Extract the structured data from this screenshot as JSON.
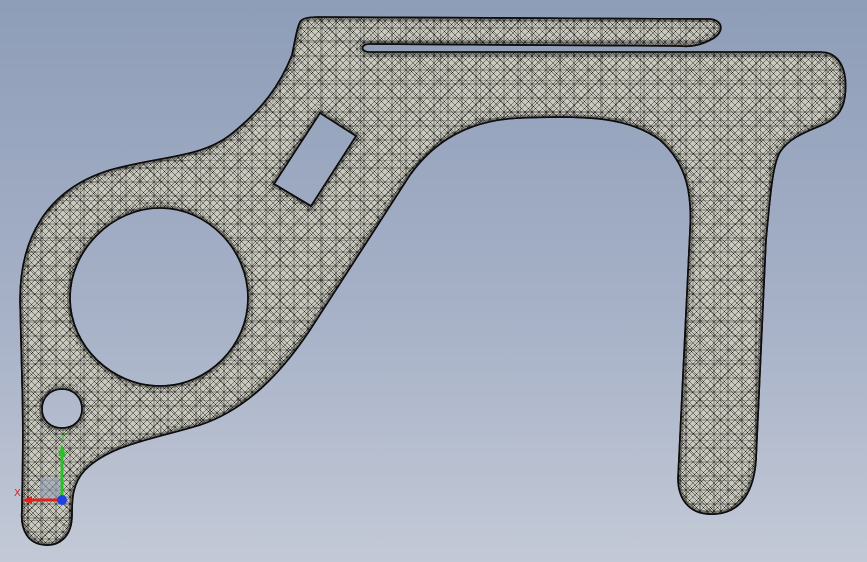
{
  "viewport": {
    "background_top": "#8e9db8",
    "background_bottom": "#c3c9d6"
  },
  "part": {
    "fill": "#c9c8bd",
    "mesh_color": "#1a1a1a"
  },
  "triad": {
    "x_label": "X",
    "y_label": "Y",
    "x_color": "#e0211b",
    "y_color": "#28c228",
    "z_color": "#2040e0",
    "icons": [
      "x-axis-icon",
      "y-axis-icon",
      "z-axis-icon"
    ]
  }
}
